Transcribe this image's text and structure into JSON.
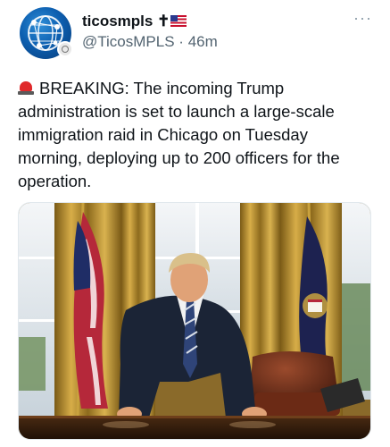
{
  "tweet": {
    "display_name": "ticosmpls",
    "name_suffix": "✝",
    "handle": "@TicosMPLS",
    "separator": "·",
    "time": "46m",
    "more_label": "···",
    "body_prefix": "BREAKING:",
    "body": " The incoming Trump administration is set to launch a large-scale immigration raid in Chicago on Tuesday morning, deploying up to 200 officers for the operation."
  },
  "icons": {
    "avatar": "globe-network-icon",
    "badge": "affiliate-badge-icon",
    "flag": "us-flag-icon",
    "siren": "police-siren-icon",
    "more": "more-options-icon"
  },
  "colors": {
    "text": "#0f1419",
    "secondary": "#536471",
    "avatar_blue": "#0d5fb0",
    "siren_red": "#e0292b"
  }
}
